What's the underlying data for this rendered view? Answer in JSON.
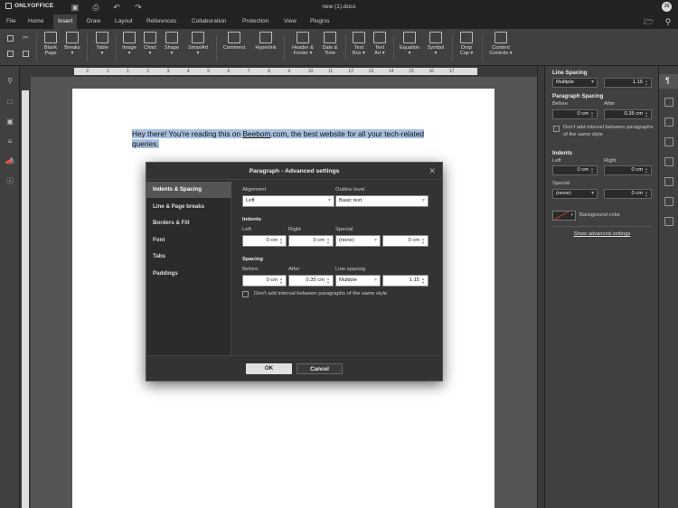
{
  "app": {
    "brand": "ONLYOFFICE",
    "doc_title": "new (1).docx",
    "avatar": "JS"
  },
  "menu": [
    "File",
    "Home",
    "Insert",
    "Draw",
    "Layout",
    "References",
    "Collaboration",
    "Protection",
    "View",
    "Plugins"
  ],
  "active_menu": "Insert",
  "toolbar": {
    "blank_page": "Blank\nPage",
    "breaks": "Breaks\n▾",
    "table": "Table\n▾",
    "image": "Image\n▾",
    "chart": "Chart\n▾",
    "shape": "Shape\n▾",
    "smartart": "SmartArt\n▾",
    "comment": "Comment",
    "hyperlink": "Hyperlink",
    "header_footer": "Header &\nFooter ▾",
    "date_time": "Date &\nTime",
    "text_box": "Text\nBox ▾",
    "text_art": "Text\nArt ▾",
    "equation": "Equation\n▾",
    "symbol": "Symbol\n▾",
    "drop_cap": "Drop\nCap ▾",
    "content_controls": "Content\nControls ▾"
  },
  "document": {
    "text_before": "Hey there! You're reading this on ",
    "link": "Beebom",
    "text_after": ".com, the best website for all your tech-related",
    "line2": "queries."
  },
  "right_panel": {
    "line_spacing_title": "Line Spacing",
    "line_spacing_mode": "Multiple",
    "line_spacing_value": "1.15",
    "paragraph_spacing_title": "Paragraph Spacing",
    "before_label": "Before",
    "after_label": "After",
    "before_value": "0 cm",
    "after_value": "0.35 cm",
    "dont_add_interval": "Don't add interval between paragraphs of the same style",
    "indents_title": "Indents",
    "left_label": "Left",
    "right_label": "Right",
    "left_value": "0 cm",
    "right_value": "0 cm",
    "special_label": "Special",
    "special_value": "(none)",
    "special_by": "0 cm",
    "background_color": "Background color",
    "show_advanced": "Show advanced settings"
  },
  "dialog": {
    "title": "Paragraph - Advanced settings",
    "nav": [
      "Indents & Spacing",
      "Line & Page breaks",
      "Borders & Fill",
      "Font",
      "Tabs",
      "Paddings"
    ],
    "selected_nav": "Indents & Spacing",
    "alignment_label": "Alignment",
    "alignment_value": "Left",
    "outline_label": "Outline level",
    "outline_value": "Basic text",
    "indents_title": "Indents",
    "left_label": "Left",
    "right_label": "Right",
    "special_label": "Special",
    "left_value": "0 cm",
    "right_value": "0 cm",
    "special_value": "(none)",
    "special_by": "0 cm",
    "spacing_title": "Spacing",
    "before_label": "Before",
    "after_label": "After",
    "line_spacing_label": "Line spacing",
    "before_value": "0 cm",
    "after_value": "0.35 cm",
    "line_spacing_mode": "Multiple",
    "line_spacing_value": "1.15",
    "checkbox_label": "Don't add interval between paragraphs of the same style",
    "ok": "OK",
    "cancel": "Cancel"
  },
  "ruler_ticks": [
    "2",
    "1",
    "1",
    "2",
    "3",
    "4",
    "5",
    "6",
    "7",
    "8",
    "9",
    "10",
    "11",
    "12",
    "13",
    "14",
    "15",
    "16",
    "17"
  ],
  "colors": {
    "accent_highlight": "#a8c0e0",
    "ok_button": "#e0e0e0",
    "background_swatch": "#c0392b"
  }
}
